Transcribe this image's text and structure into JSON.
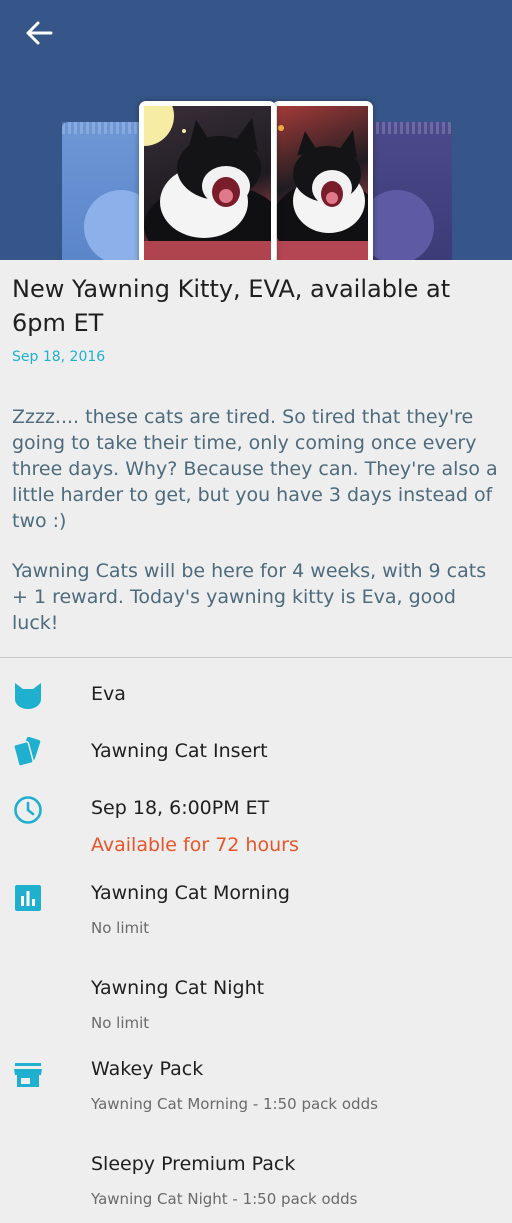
{
  "header": {
    "back_icon": "arrow-left-icon",
    "background": "#365689"
  },
  "article": {
    "title": "New Yawning Kitty, EVA, available at 6pm ET",
    "date": "Sep 18, 2016",
    "paragraphs": [
      "Zzzz.... these cats are tired. So tired that they're going to take their time, only coming once every three days. Why? Because they can. They're also a little harder to get, but you have 3 days instead of two :)",
      "Yawning Cats will be here for 4 weeks, with 9 cats + 1 reward. Today's yawning kitty is Eva, good luck!"
    ]
  },
  "details": {
    "cat": {
      "icon": "cat-icon",
      "name": "Eva"
    },
    "insert": {
      "icon": "cards-icon",
      "name": "Yawning Cat Insert"
    },
    "time": {
      "icon": "clock-icon",
      "when": "Sep 18, 6:00PM ET",
      "availability": "Available for 72 hours"
    },
    "limits": {
      "icon": "bar-chart-icon",
      "items": [
        {
          "name": "Yawning Cat Morning",
          "limit": "No limit"
        },
        {
          "name": "Yawning Cat Night",
          "limit": "No limit"
        }
      ]
    },
    "packs": {
      "icon": "store-icon",
      "items": [
        {
          "name": "Wakey Pack",
          "odds": "Yawning Cat Morning - 1:50 pack odds"
        },
        {
          "name": "Sleepy Premium Pack",
          "odds": "Yawning Cat Night - 1:50 pack odds"
        }
      ]
    }
  },
  "colors": {
    "accent": "#1fb0cf",
    "alert": "#e8552a",
    "body_text": "#4d6b7c"
  }
}
